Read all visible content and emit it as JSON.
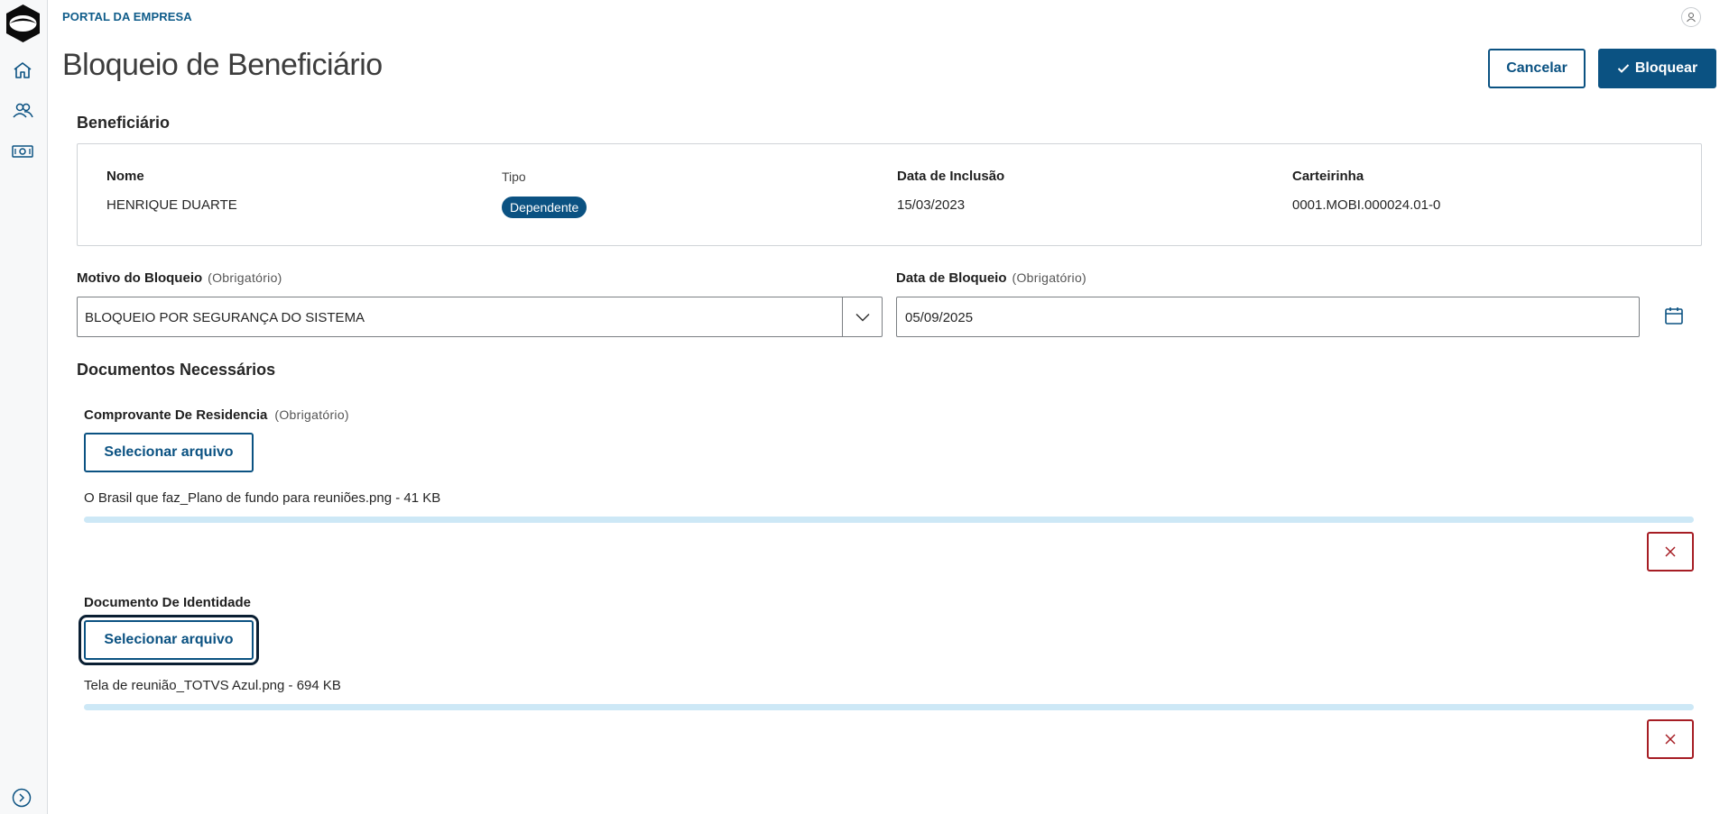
{
  "header": {
    "portal_title": "PORTAL DA EMPRESA",
    "page_title": "Bloqueio de Beneficiário",
    "cancel_label": "Cancelar",
    "block_label": "Bloquear"
  },
  "sidebar": {
    "items": [
      {
        "icon": "home-icon"
      },
      {
        "icon": "users-icon"
      },
      {
        "icon": "money-icon"
      }
    ],
    "expand_icon": "chevron-right-circle-icon"
  },
  "beneficiary": {
    "section_title": "Beneficiário",
    "name_label": "Nome",
    "name_value": "HENRIQUE DUARTE",
    "type_label": "Tipo",
    "type_value": "Dependente",
    "inclusion_label": "Data de Inclusão",
    "inclusion_value": "15/03/2023",
    "card_label": "Carteirinha",
    "card_value": "0001.MOBI.000024.01-0"
  },
  "form": {
    "reason_label": "Motivo do Bloqueio",
    "reason_required": "(Obrigatório)",
    "reason_value": "BLOQUEIO POR SEGURANÇA DO SISTEMA",
    "date_label": "Data de Bloqueio",
    "date_required": "(Obrigatório)",
    "date_value": "05/09/2025"
  },
  "documents": {
    "section_title": "Documentos Necessários",
    "items": [
      {
        "label": "Comprovante De Residencia",
        "required": "(Obrigatório)",
        "button_label": "Selecionar arquivo",
        "file": "O Brasil que faz_Plano de fundo para reuniões.png - 41 KB",
        "progress": 1.0
      },
      {
        "label": "Documento De Identidade",
        "button_label": "Selecionar arquivo",
        "file": "Tela de reunião_TOTVS Azul.png - 694 KB",
        "progress": 1.0
      }
    ]
  },
  "colors": {
    "primary": "#0b5282",
    "danger": "#a61d24",
    "progress": "#d9ecf7"
  }
}
